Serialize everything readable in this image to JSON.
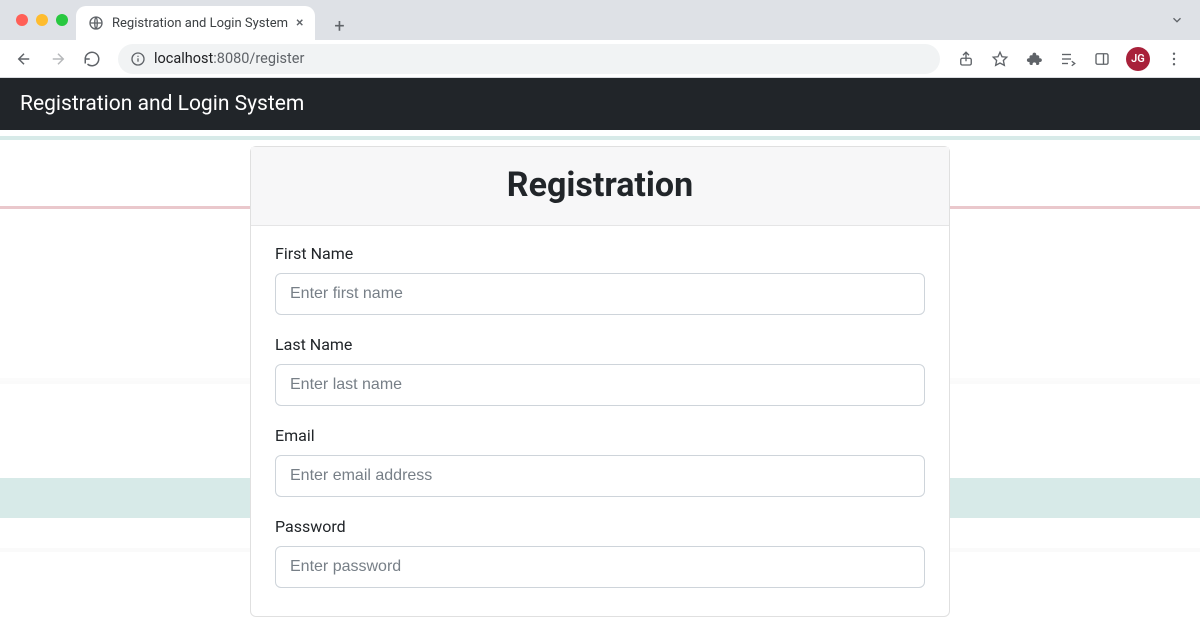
{
  "browser": {
    "tab_title": "Registration and Login System",
    "url_host": "localhost",
    "url_port_path": ":8080/register",
    "profile_initials": "JG"
  },
  "navbar": {
    "brand": "Registration and Login System"
  },
  "card": {
    "header": "Registration"
  },
  "form": {
    "first_name": {
      "label": "First Name",
      "placeholder": "Enter first name"
    },
    "last_name": {
      "label": "Last Name",
      "placeholder": "Enter last name"
    },
    "email": {
      "label": "Email",
      "placeholder": "Enter email address"
    },
    "password": {
      "label": "Password",
      "placeholder": "Enter password"
    }
  }
}
